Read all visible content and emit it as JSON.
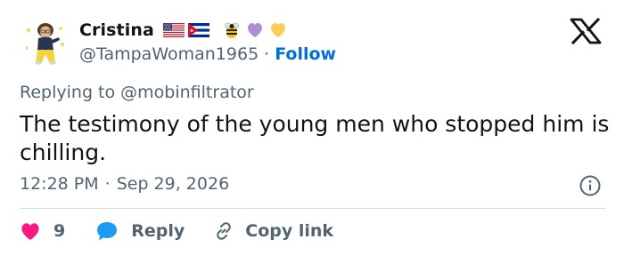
{
  "author": {
    "display_name": "Cristina",
    "handle": "@TampaWoman1965",
    "separator": "·",
    "follow_label": "Follow",
    "emoji_names": [
      "us-flag",
      "cuba-flag",
      "bee",
      "purple-heart",
      "yellow-heart"
    ]
  },
  "reply_context": {
    "prefix": "Replying to",
    "mention": "@mobinfiltrator"
  },
  "tweet": {
    "text": "The testimony of the young men who stopped him is chilling.",
    "time": "12:28 PM",
    "separator": "·",
    "date": "Sep 29, 2026"
  },
  "actions": {
    "like_count": "9",
    "reply_label": "Reply",
    "copy_link_label": "Copy link"
  },
  "colors": {
    "link_blue": "#006fd6",
    "like_pink": "#f91880",
    "reply_blue": "#1d9bf0",
    "muted_gray": "#536471"
  },
  "icons": {
    "brand": "x-logo-icon",
    "info": "info-icon",
    "like": "heart-icon",
    "reply": "speech-bubble-icon",
    "copy": "link-icon"
  }
}
